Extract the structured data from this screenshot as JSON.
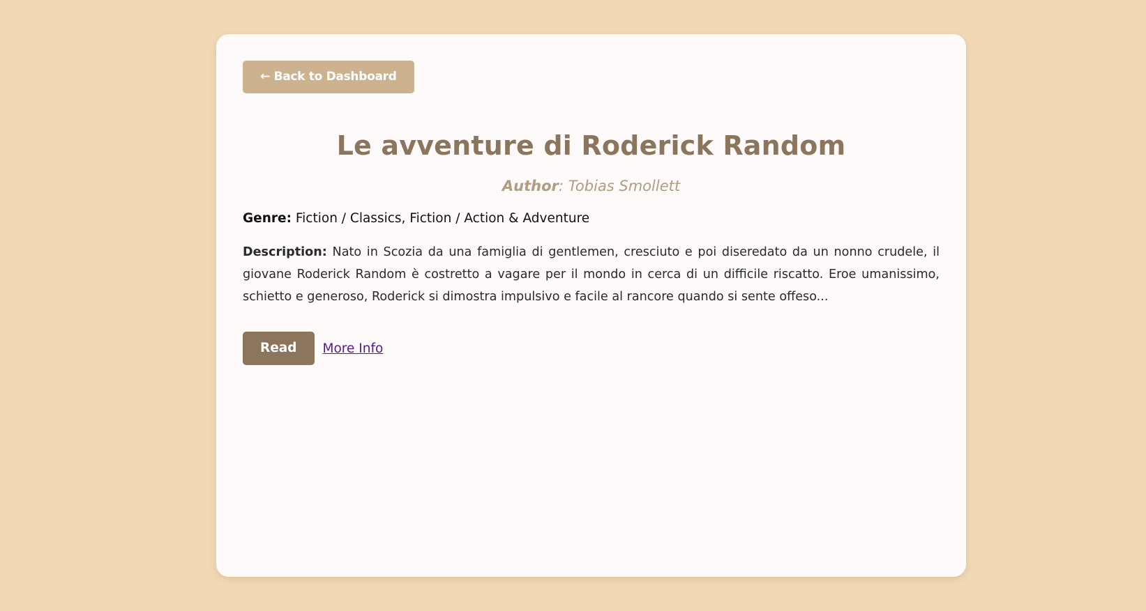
{
  "nav": {
    "back_label": "← Back to Dashboard"
  },
  "book": {
    "title": "Le avventure di Roderick Random",
    "author_label": "Author",
    "author_sep": ":",
    "author": "Tobias Smollett",
    "genre_label": "Genre:",
    "genre": "Fiction / Classics, Fiction / Action & Adventure",
    "description_label": "Description:",
    "description": "Nato in Scozia da una famiglia di gentlemen, cresciuto e poi diseredato da un nonno crudele, il giovane Roderick Random è costretto a vagare per il mondo in cerca di un difficile riscatto. Eroe umanissimo, schietto e generoso, Roderick si dimostra impulsivo e facile al rancore quando si sente offeso..."
  },
  "actions": {
    "read_label": "Read",
    "more_info_label": "More Info"
  },
  "colors": {
    "page_bg": "#f2d9b5",
    "card_bg": "#fefaf9",
    "back_button": "#cdb290",
    "title": "#8b755d",
    "author": "#b09d82",
    "read_button": "#8b755d",
    "link": "#551a8b"
  }
}
